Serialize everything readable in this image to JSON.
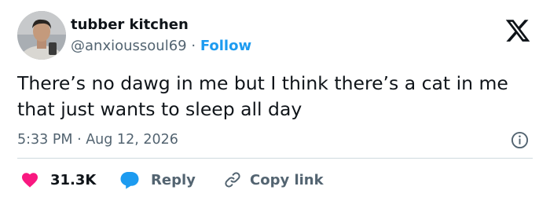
{
  "author": {
    "display_name": "tubber kitchen",
    "handle": "@anxioussoul69",
    "separator": "·",
    "follow_label": "Follow"
  },
  "tweet": {
    "text": "There’s no dawg in me but I think there’s a cat in me that just wants to sleep all day",
    "timestamp": "5:33 PM · Aug 12, 2026"
  },
  "actions": {
    "like_count": "31.3K",
    "reply_label": "Reply",
    "copy_label": "Copy link"
  },
  "icons": {
    "brand": "x-logo-icon",
    "info": "info-icon",
    "like": "heart-icon",
    "reply": "reply-bubble-icon",
    "copy": "link-icon"
  },
  "colors": {
    "text": "#0f1419",
    "secondary_text": "#536471",
    "accent_blue": "#1d9bf0",
    "like_pink": "#f91880",
    "divider": "#cfd9de"
  }
}
